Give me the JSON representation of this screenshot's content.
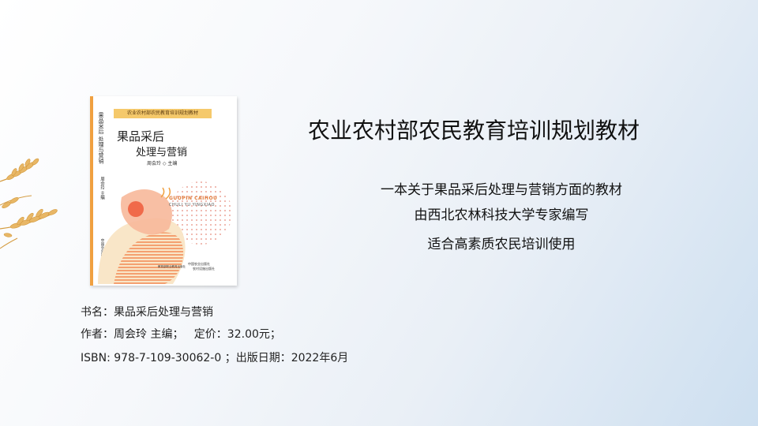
{
  "slide": {
    "title": "农业农村部农民教育培训规划教材",
    "descriptions": [
      "一本关于果品采后处理与营销方面的教材",
      "由西北农林科技大学专家编写",
      "适合高素质农民培训使用"
    ]
  },
  "book_info": {
    "line1": "书名：果品采后处理与营销",
    "line2": "作者：周会玲 主编；   定价：32.00元；",
    "line3": "ISBN: 978-7-109-30062-0 ；出版日期：2022年6月"
  },
  "cover": {
    "series": "农业农村部农民教育培训规划教材",
    "spine_title": "果品采后 处理与营销",
    "spine_author": "周会玲 主编",
    "spine_publisher": "中国农业出版社",
    "title_line1": "果品采后",
    "title_line2": "处理与营销",
    "editor": "周会玲 ◇ 主编",
    "pinyin_line1": "GUOPIN CAIHOU",
    "pinyin_line2": "CHULI YU YINGXIAO",
    "publisher_left": "教育部职业教育出版社",
    "publisher_right_1": "中国农业出版社",
    "publisher_right_2": "农村设施出版社"
  },
  "colors": {
    "accent_orange": "#f0a040",
    "art_peach": "#f7b89a",
    "art_red": "#f06a4a",
    "art_cream": "#f9e6c8"
  },
  "icons": [
    "wheat-decoration-icon"
  ]
}
